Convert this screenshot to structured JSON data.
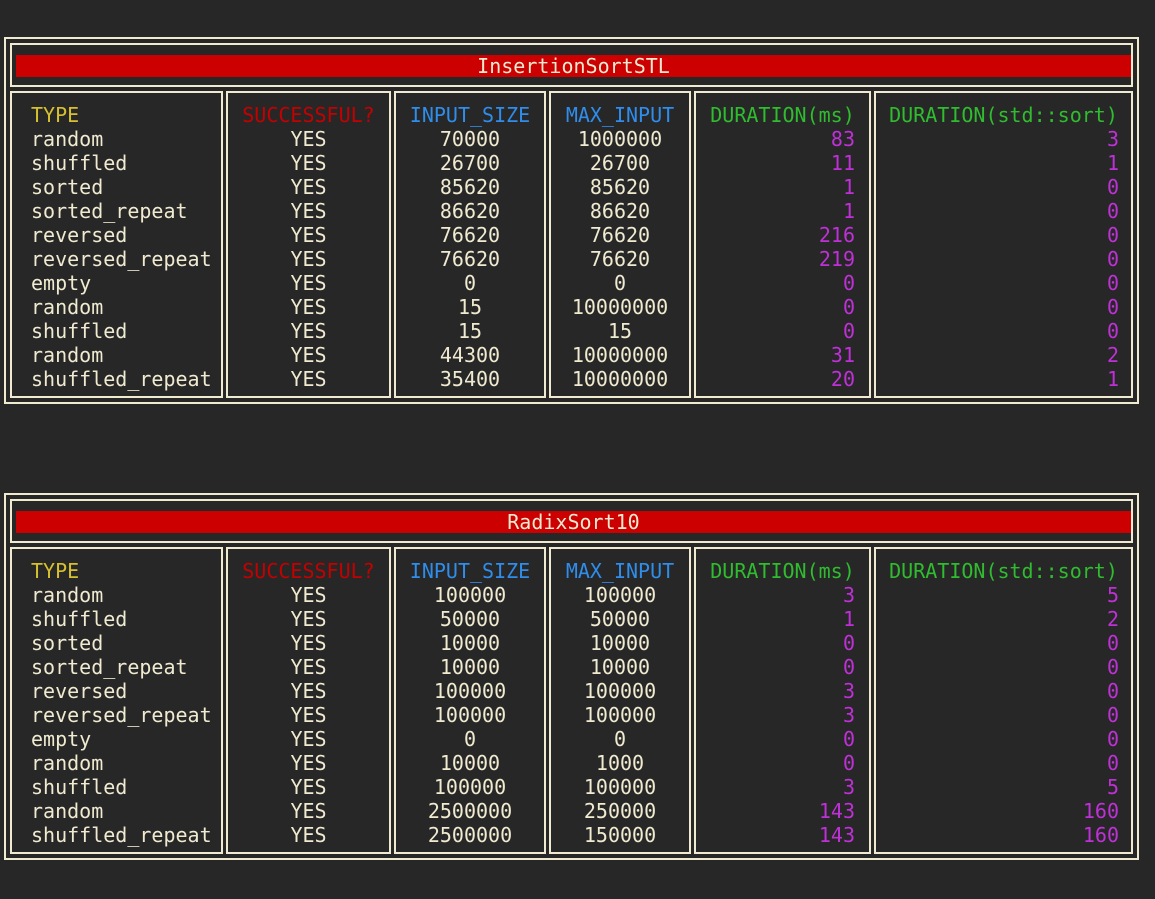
{
  "headers": {
    "type": "TYPE",
    "successful": "SUCCESSFUL?",
    "input_size": "INPUT_SIZE",
    "max_input": "MAX_INPUT",
    "duration": "DURATION(ms)",
    "std_sort": "DURATION(std::sort)"
  },
  "colors": {
    "background": "#272727",
    "border": "#f0ead0",
    "title_bar": "#cc0000",
    "text": "#f0ead0",
    "type_header": "#d7c02f",
    "successful_header": "#c40000",
    "size_headers": "#2f8dec",
    "duration_headers": "#2fbd2f",
    "duration_values": "#c030d8"
  },
  "tables": [
    {
      "title": "InsertionSortSTL",
      "rows": [
        {
          "type": "random",
          "successful": "YES",
          "input_size": "70000",
          "max_input": "1000000",
          "duration": "83",
          "std_sort": "3"
        },
        {
          "type": "shuffled",
          "successful": "YES",
          "input_size": "26700",
          "max_input": "26700",
          "duration": "11",
          "std_sort": "1"
        },
        {
          "type": "sorted",
          "successful": "YES",
          "input_size": "85620",
          "max_input": "85620",
          "duration": "1",
          "std_sort": "0"
        },
        {
          "type": "sorted_repeat",
          "successful": "YES",
          "input_size": "86620",
          "max_input": "86620",
          "duration": "1",
          "std_sort": "0"
        },
        {
          "type": "reversed",
          "successful": "YES",
          "input_size": "76620",
          "max_input": "76620",
          "duration": "216",
          "std_sort": "0"
        },
        {
          "type": "reversed_repeat",
          "successful": "YES",
          "input_size": "76620",
          "max_input": "76620",
          "duration": "219",
          "std_sort": "0"
        },
        {
          "type": "empty",
          "successful": "YES",
          "input_size": "0",
          "max_input": "0",
          "duration": "0",
          "std_sort": "0"
        },
        {
          "type": "random",
          "successful": "YES",
          "input_size": "15",
          "max_input": "10000000",
          "duration": "0",
          "std_sort": "0"
        },
        {
          "type": "shuffled",
          "successful": "YES",
          "input_size": "15",
          "max_input": "15",
          "duration": "0",
          "std_sort": "0"
        },
        {
          "type": "random",
          "successful": "YES",
          "input_size": "44300",
          "max_input": "10000000",
          "duration": "31",
          "std_sort": "2"
        },
        {
          "type": "shuffled_repeat",
          "successful": "YES",
          "input_size": "35400",
          "max_input": "10000000",
          "duration": "20",
          "std_sort": "1"
        }
      ]
    },
    {
      "title": "RadixSort10",
      "rows": [
        {
          "type": "random",
          "successful": "YES",
          "input_size": "100000",
          "max_input": "100000",
          "duration": "3",
          "std_sort": "5"
        },
        {
          "type": "shuffled",
          "successful": "YES",
          "input_size": "50000",
          "max_input": "50000",
          "duration": "1",
          "std_sort": "2"
        },
        {
          "type": "sorted",
          "successful": "YES",
          "input_size": "10000",
          "max_input": "10000",
          "duration": "0",
          "std_sort": "0"
        },
        {
          "type": "sorted_repeat",
          "successful": "YES",
          "input_size": "10000",
          "max_input": "10000",
          "duration": "0",
          "std_sort": "0"
        },
        {
          "type": "reversed",
          "successful": "YES",
          "input_size": "100000",
          "max_input": "100000",
          "duration": "3",
          "std_sort": "0"
        },
        {
          "type": "reversed_repeat",
          "successful": "YES",
          "input_size": "100000",
          "max_input": "100000",
          "duration": "3",
          "std_sort": "0"
        },
        {
          "type": "empty",
          "successful": "YES",
          "input_size": "0",
          "max_input": "0",
          "duration": "0",
          "std_sort": "0"
        },
        {
          "type": "random",
          "successful": "YES",
          "input_size": "10000",
          "max_input": "1000",
          "duration": "0",
          "std_sort": "0"
        },
        {
          "type": "shuffled",
          "successful": "YES",
          "input_size": "100000",
          "max_input": "100000",
          "duration": "3",
          "std_sort": "5"
        },
        {
          "type": "random",
          "successful": "YES",
          "input_size": "2500000",
          "max_input": "250000",
          "duration": "143",
          "std_sort": "160"
        },
        {
          "type": "shuffled_repeat",
          "successful": "YES",
          "input_size": "2500000",
          "max_input": "150000",
          "duration": "143",
          "std_sort": "160"
        }
      ]
    }
  ]
}
